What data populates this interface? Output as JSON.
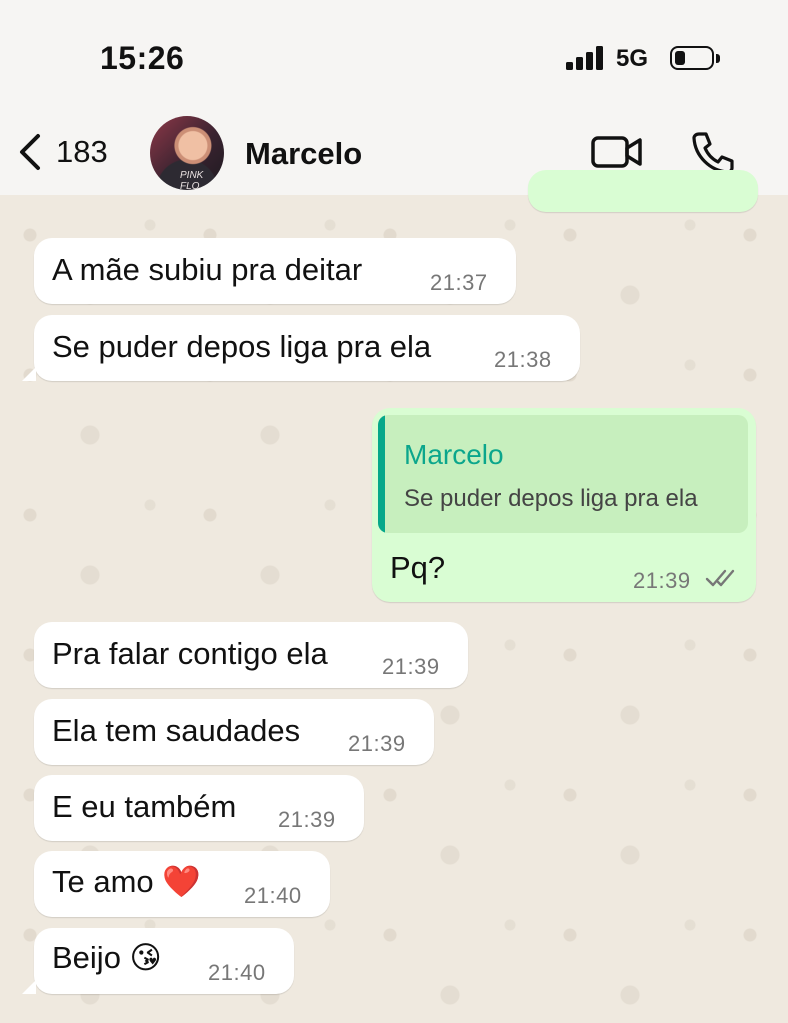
{
  "status_bar": {
    "time": "15:26",
    "network": "5G"
  },
  "header": {
    "back_count": "183",
    "contact_name": "Marcelo",
    "avatar_text": "PINK FLO"
  },
  "messages": [
    {
      "text": "A mãe  subiu pra deitar",
      "time": "21:37"
    },
    {
      "text": "Se puder depos liga pra ela",
      "time": "21:38"
    },
    {
      "quote_author": "Marcelo",
      "quote_text": "Se puder depos liga pra ela",
      "text": "Pq?",
      "time": "21:39"
    },
    {
      "text": "Pra falar contigo ela",
      "time": "21:39"
    },
    {
      "text": "Ela tem saudades",
      "time": "21:39"
    },
    {
      "text": "E eu também",
      "time": "21:39"
    },
    {
      "text": "Te amo ❤️",
      "time": "21:40"
    },
    {
      "text": "Beijo 😘",
      "time": "21:40"
    }
  ],
  "colors": {
    "incoming": "#ffffff",
    "outgoing": "#d9fdd3",
    "accent": "#06a88a",
    "background": "#efe9df"
  },
  "icons": {
    "back": "chevron-left-icon",
    "video": "video-camera-icon",
    "call": "phone-icon",
    "read": "double-check-icon"
  }
}
